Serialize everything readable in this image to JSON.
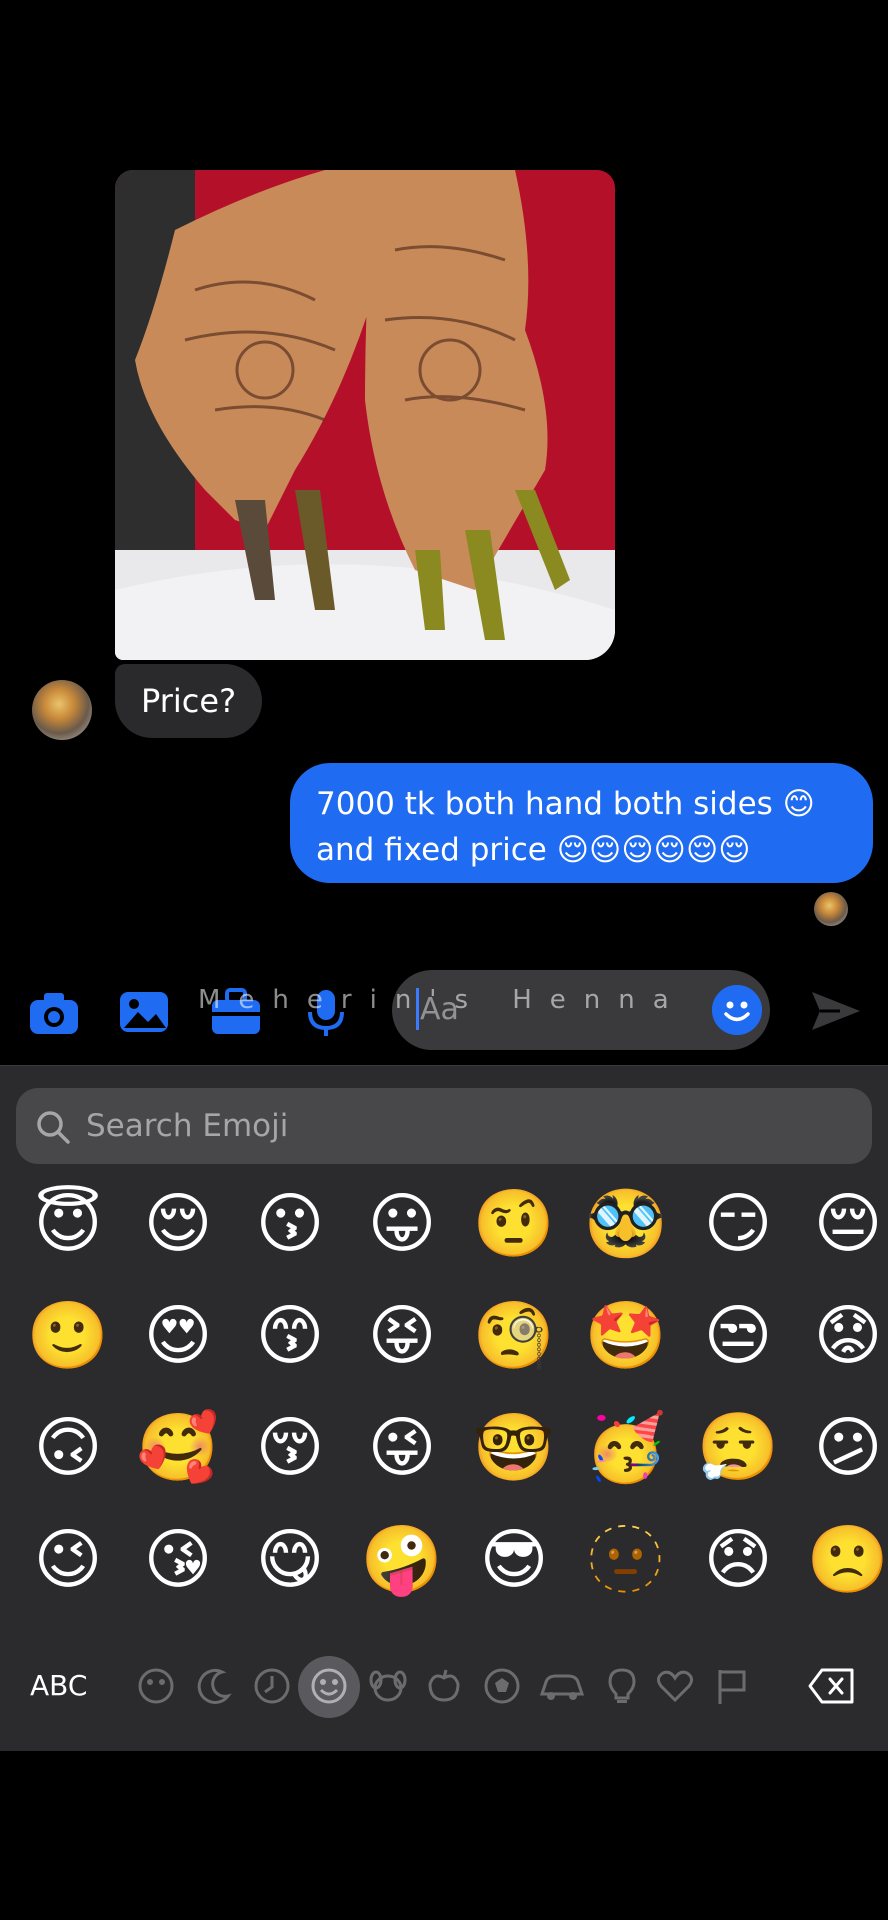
{
  "conversation": {
    "received_message": "Price?",
    "sent_message_line1": "7000 tk both hand both sides 😊",
    "sent_message_line2": "and fixed price 😌😌😌😌😌😌"
  },
  "composer": {
    "watermark": "Meherin's Henna",
    "placeholder": "Aa"
  },
  "emoji_keyboard": {
    "search_placeholder": "Search Emoji",
    "abc_label": "ABC",
    "emojis": [
      [
        "😇",
        "😌",
        "😗",
        "😛",
        "🤨",
        "🥸",
        "😏",
        "😔"
      ],
      [
        "🙂",
        "😍",
        "😙",
        "😝",
        "🧐",
        "🤩",
        "😒",
        "😟"
      ],
      [
        "🙃",
        "🥰",
        "😚",
        "😜",
        "🤓",
        "🥳",
        "😮‍💨",
        "😕"
      ],
      [
        "😉",
        "😘",
        "😋",
        "🤪",
        "😎",
        "🫥",
        "😞",
        "🙁"
      ]
    ],
    "categories": [
      "smileys-frequent",
      "moon-icon",
      "clock-icon",
      "smiley-icon",
      "dog-icon",
      "apple-icon",
      "ball-icon",
      "car-icon",
      "bulb-icon",
      "heart-icon",
      "flag-icon"
    ],
    "active_category": "smiley-icon"
  },
  "colors": {
    "accent": "#1f6bf2",
    "background": "#000000",
    "keyboard_bg": "#2b2b2d"
  }
}
